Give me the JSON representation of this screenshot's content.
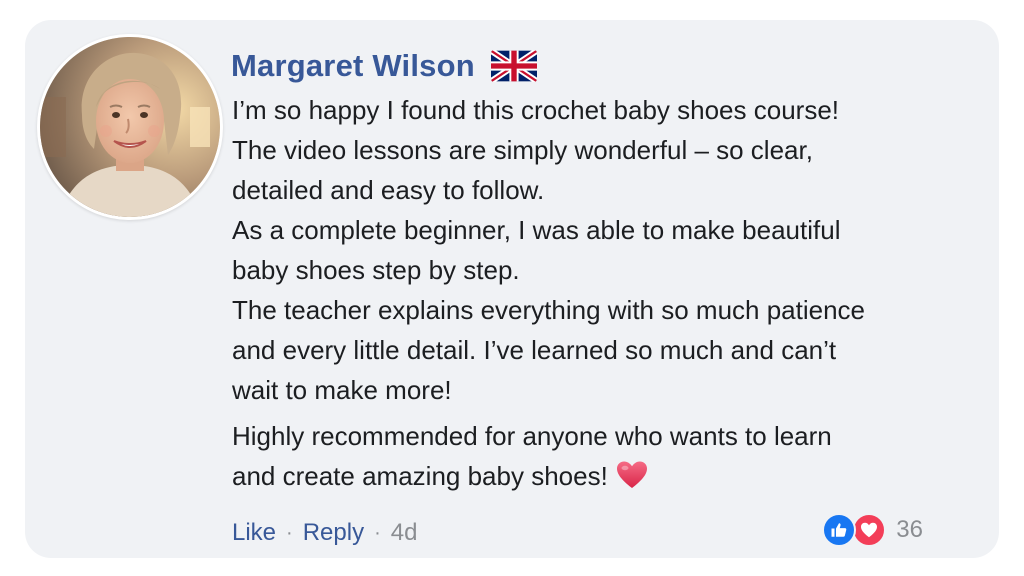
{
  "comment": {
    "author": "Margaret Wilson",
    "flag_icon": "uk-flag-icon",
    "body_lines": [
      "I’m so happy I found this crochet baby shoes course!",
      "The video lessons are simply wonderful – so clear,",
      "detailed and easy to follow.",
      "As a complete beginner,  I was able to make beautiful",
      "baby shoes step by step.",
      "The teacher explains everything with so much patience",
      "and every little detail. I’ve learned so much and can’t",
      "wait to make more!",
      "Highly recommended for anyone who wants to learn",
      "and create amazing baby shoes!"
    ],
    "emoji": "heart-emoji",
    "actions": {
      "like_label": "Like",
      "reply_label": "Reply",
      "separator": "·",
      "timestamp": "4d"
    },
    "reactions": {
      "icons": [
        "like-icon",
        "love-icon"
      ],
      "count": "36"
    }
  },
  "colors": {
    "card_background": "#f0f2f5",
    "name_color": "#385898",
    "link_color": "#385898",
    "text_color": "#1c1e21",
    "muted_color": "#8a8d91",
    "like_blue": "#1877f2",
    "love_red": "#f33e58"
  }
}
